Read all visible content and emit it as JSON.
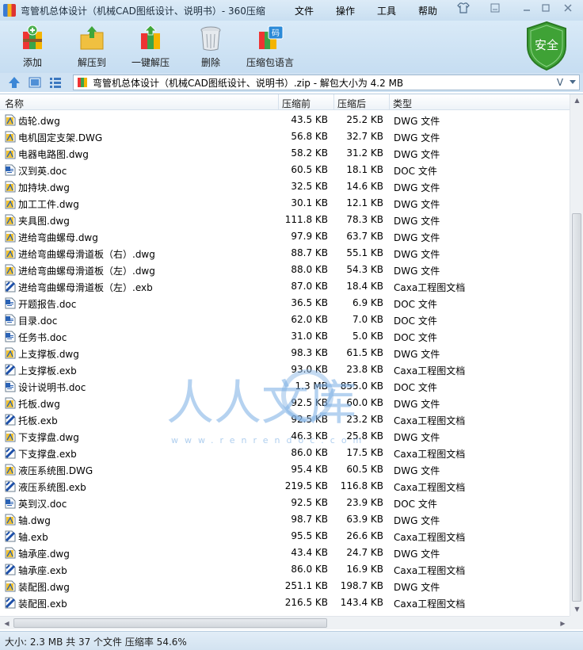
{
  "window": {
    "title": "弯管机总体设计（机械CAD图纸设计、说明书）- 360压缩",
    "menu": [
      "文件",
      "操作",
      "工具",
      "帮助"
    ],
    "controls": [
      "minimize",
      "maximize",
      "close"
    ]
  },
  "toolbar": {
    "buttons": [
      {
        "label": "添加",
        "icon": "add-archive-icon"
      },
      {
        "label": "解压到",
        "icon": "extract-to-icon"
      },
      {
        "label": "一键解压",
        "icon": "one-click-extract-icon"
      },
      {
        "label": "删除",
        "icon": "trash-icon"
      },
      {
        "label": "压缩包语言",
        "icon": "archive-language-icon"
      }
    ],
    "security_badge": "安全"
  },
  "address": {
    "path": "弯管机总体设计（机械CAD图纸设计、说明书）.zip - 解包大小为 4.2 MB",
    "dropdown": "V"
  },
  "columns": {
    "name": "名称",
    "size": "压缩前",
    "compressed": "压缩后",
    "type": "类型"
  },
  "files": [
    {
      "name": "齿轮.dwg",
      "size": "43.5 KB",
      "compressed": "25.2 KB",
      "type": "DWG 文件",
      "kind": "dwg"
    },
    {
      "name": "电机固定支架.DWG",
      "size": "56.8 KB",
      "compressed": "32.7 KB",
      "type": "DWG 文件",
      "kind": "dwg"
    },
    {
      "name": "电器电路图.dwg",
      "size": "58.2 KB",
      "compressed": "31.2 KB",
      "type": "DWG 文件",
      "kind": "dwg"
    },
    {
      "name": "汉到英.doc",
      "size": "60.5 KB",
      "compressed": "18.1 KB",
      "type": "DOC 文件",
      "kind": "doc"
    },
    {
      "name": "加持块.dwg",
      "size": "32.5 KB",
      "compressed": "14.6 KB",
      "type": "DWG 文件",
      "kind": "dwg"
    },
    {
      "name": "加工工件.dwg",
      "size": "30.1 KB",
      "compressed": "12.1 KB",
      "type": "DWG 文件",
      "kind": "dwg"
    },
    {
      "name": "夹具图.dwg",
      "size": "111.8 KB",
      "compressed": "78.3 KB",
      "type": "DWG 文件",
      "kind": "dwg"
    },
    {
      "name": "进给弯曲螺母.dwg",
      "size": "97.9 KB",
      "compressed": "63.7 KB",
      "type": "DWG 文件",
      "kind": "dwg"
    },
    {
      "name": "进给弯曲螺母滑道板（右）.dwg",
      "size": "88.7 KB",
      "compressed": "55.1 KB",
      "type": "DWG 文件",
      "kind": "dwg"
    },
    {
      "name": "进给弯曲螺母滑道板（左）.dwg",
      "size": "88.0 KB",
      "compressed": "54.3 KB",
      "type": "DWG 文件",
      "kind": "dwg"
    },
    {
      "name": "进给弯曲螺母滑道板（左）.exb",
      "size": "87.0 KB",
      "compressed": "18.4 KB",
      "type": "Caxa工程图文档",
      "kind": "exb"
    },
    {
      "name": "开题报告.doc",
      "size": "36.5 KB",
      "compressed": "6.9 KB",
      "type": "DOC 文件",
      "kind": "doc"
    },
    {
      "name": "目录.doc",
      "size": "62.0 KB",
      "compressed": "7.0 KB",
      "type": "DOC 文件",
      "kind": "doc"
    },
    {
      "name": "任务书.doc",
      "size": "31.0 KB",
      "compressed": "5.0 KB",
      "type": "DOC 文件",
      "kind": "doc"
    },
    {
      "name": "上支撑板.dwg",
      "size": "98.3 KB",
      "compressed": "61.5 KB",
      "type": "DWG 文件",
      "kind": "dwg"
    },
    {
      "name": "上支撑板.exb",
      "size": "93.0 KB",
      "compressed": "23.8 KB",
      "type": "Caxa工程图文档",
      "kind": "exb"
    },
    {
      "name": "设计说明书.doc",
      "size": "1.3 MB",
      "compressed": "855.0 KB",
      "type": "DOC 文件",
      "kind": "doc"
    },
    {
      "name": "托板.dwg",
      "size": "92.5 KB",
      "compressed": "60.0 KB",
      "type": "DWG 文件",
      "kind": "dwg"
    },
    {
      "name": "托板.exb",
      "size": "92.5 KB",
      "compressed": "23.2 KB",
      "type": "Caxa工程图文档",
      "kind": "exb"
    },
    {
      "name": "下支撑盘.dwg",
      "size": "46.3 KB",
      "compressed": "25.8 KB",
      "type": "DWG 文件",
      "kind": "dwg"
    },
    {
      "name": "下支撑盘.exb",
      "size": "86.0 KB",
      "compressed": "17.5 KB",
      "type": "Caxa工程图文档",
      "kind": "exb"
    },
    {
      "name": "液压系统图.DWG",
      "size": "95.4 KB",
      "compressed": "60.5 KB",
      "type": "DWG 文件",
      "kind": "dwg"
    },
    {
      "name": "液压系统图.exb",
      "size": "219.5 KB",
      "compressed": "116.8 KB",
      "type": "Caxa工程图文档",
      "kind": "exb"
    },
    {
      "name": "英到汉.doc",
      "size": "92.5 KB",
      "compressed": "23.9 KB",
      "type": "DOC 文件",
      "kind": "doc"
    },
    {
      "name": "轴.dwg",
      "size": "98.7 KB",
      "compressed": "63.9 KB",
      "type": "DWG 文件",
      "kind": "dwg"
    },
    {
      "name": "轴.exb",
      "size": "95.5 KB",
      "compressed": "26.6 KB",
      "type": "Caxa工程图文档",
      "kind": "exb"
    },
    {
      "name": "轴承座.dwg",
      "size": "43.4 KB",
      "compressed": "24.7 KB",
      "type": "DWG 文件",
      "kind": "dwg"
    },
    {
      "name": "轴承座.exb",
      "size": "86.0 KB",
      "compressed": "16.9 KB",
      "type": "Caxa工程图文档",
      "kind": "exb"
    },
    {
      "name": "装配图.dwg",
      "size": "251.1 KB",
      "compressed": "198.7 KB",
      "type": "DWG 文件",
      "kind": "dwg"
    },
    {
      "name": "装配图.exb",
      "size": "216.5 KB",
      "compressed": "143.4 KB",
      "type": "Caxa工程图文档",
      "kind": "exb"
    }
  ],
  "watermark": {
    "text": "人人文库",
    "url": "www.renrendoc.com"
  },
  "status": "大小: 2.3 MB 共 37 个文件 压缩率 54.6%",
  "colors": {
    "titlebar": "#dcebf7",
    "toolbar": "#c6ddf1",
    "shield": "#3fa236",
    "watermark": "#4a90d9"
  }
}
